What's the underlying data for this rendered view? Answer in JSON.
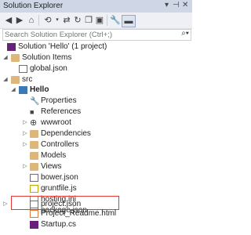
{
  "window": {
    "title": "Solution Explorer",
    "pin_icon": "pin-icon",
    "close_icon": "close-icon"
  },
  "toolbar": {
    "buttons": [
      "home-icon",
      "back-icon",
      "forward-icon",
      "sync-icon",
      "history-icon",
      "refresh-icon",
      "copy-icon",
      "collapse-icon",
      "properties-wrench-icon",
      "preview-icon"
    ]
  },
  "search": {
    "placeholder": "Search Solution Explorer (Ctrl+;)"
  },
  "tree": {
    "solution": "Solution 'Hello' (1 project)",
    "solution_items": "Solution Items",
    "global_json": "global.json",
    "src": "src",
    "project": "Hello",
    "properties": "Properties",
    "references": "References",
    "wwwroot": "wwwroot",
    "dependencies": "Dependencies",
    "controllers": "Controllers",
    "models": "Models",
    "views": "Views",
    "bower_json": "bower.json",
    "gruntfile": "gruntfile.js",
    "hosting": "hosting.ini",
    "package_json": "package.json",
    "project_json": "project.json",
    "readme": "Project_Readme.html",
    "startup": "Startup.cs"
  }
}
